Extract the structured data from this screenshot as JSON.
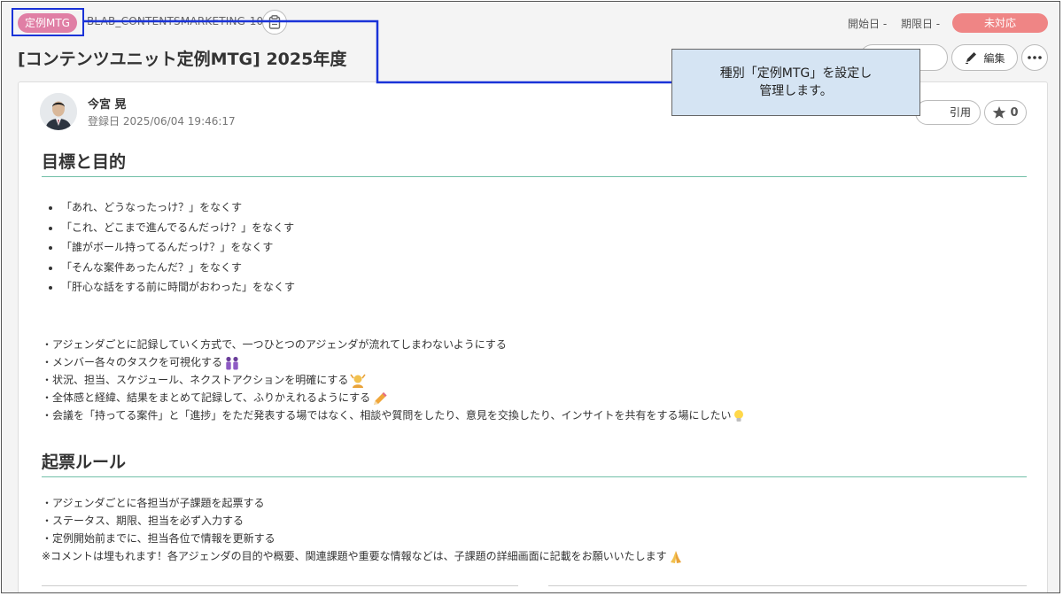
{
  "header": {
    "type_tag": "定例MTG",
    "issue_key": "BLAB_CONTENTSMARKETING-10",
    "start_label": "開始日 -",
    "due_label": "期限日 -",
    "status": "未対応",
    "title": "[コンテンツユニット定例MTG] 2025年度",
    "edit_label": "編集"
  },
  "author": {
    "name": "今宮 晃",
    "registered": "登録日 2025/06/04 19:46:17",
    "quote_label": "引用",
    "star_count": "0"
  },
  "section1": {
    "heading": "目標と目的",
    "bullets": [
      "「あれ、どうなったっけ？」をなくす",
      "「これ、どこまで進んでるんだっけ？」をなくす",
      "「誰がボール持ってるんだっけ？」をなくす",
      "「そんな案件あったんだ？」をなくす",
      "「肝心な話をする前に時間がおわった」をなくす"
    ],
    "lines": [
      "・アジェンダごとに記録していく方式で、一つひとつのアジェンダが流れてしまわないようにする",
      "・メンバー各々のタスクを可視化する",
      "・状況、担当、スケジュール、ネクストアクションを明確にする",
      "・全体感と経緯、結果をまとめて記録して、ふりかえれるようにする",
      "・会議を「持ってる案件」と「進捗」をただ発表する場ではなく、相談や質問をしたり、意見を交換したり、インサイトを共有をする場にしたい"
    ]
  },
  "section2": {
    "heading": "起票ルール",
    "lines": [
      "・アジェンダごとに各担当が子課題を起票する",
      "・ステータス、期限、担当を必ず入力する",
      "・定例開始前までに、担当各位で情報を更新する",
      "※コメントは埋もれます！各アジェンダの目的や概要、関連課題や重要な情報などは、子課題の詳細画面に記載をお願いいたします"
    ]
  },
  "callout": {
    "line1": "種別「定例MTG」を設定し",
    "line2": "管理します。"
  },
  "colors": {
    "type_tag": "#e07fa5",
    "status": "#ef8585",
    "heading_rule": "#72c0a8",
    "annotation_box": "#1a33d8",
    "callout_bg": "#d5e4f3"
  }
}
